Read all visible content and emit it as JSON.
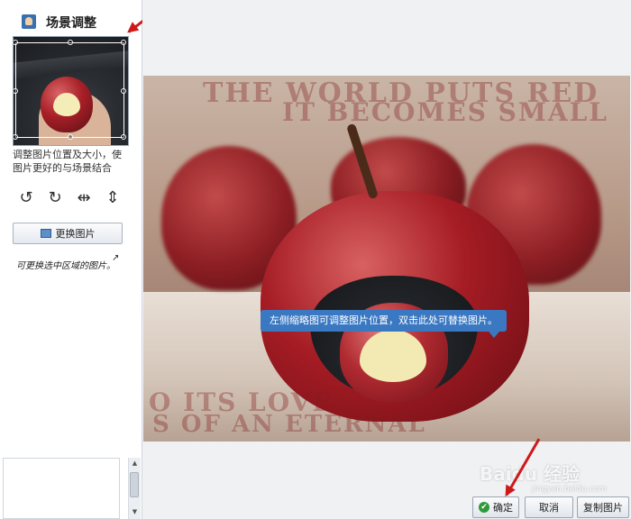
{
  "panel": {
    "title": "场景调整",
    "hint": "调整图片位置及大小，使图片更好的与场景结合",
    "tools": [
      {
        "icon": "rotate-left-icon",
        "glyph": "↺"
      },
      {
        "icon": "rotate-right-icon",
        "glyph": "↻"
      },
      {
        "icon": "flip-horizontal-icon",
        "glyph": "⇹"
      },
      {
        "icon": "flip-vertical-icon",
        "glyph": "⇕"
      }
    ],
    "replace_label": "更换图片",
    "handwritten_note": "可更换选中区域的图片。"
  },
  "preview": {
    "tooltip": "左侧缩略图可调整图片位置，双击此处可替换图片。",
    "overlay_lines": [
      "THE WORLD PUTS RED",
      "IT BECOMES SMALL",
      "O ITS LOVE",
      "S OF AN ETERNAL"
    ]
  },
  "buttons": {
    "confirm_label": "确定",
    "cancel_label": "取消",
    "copy_label": "复制图片"
  },
  "watermark": {
    "main": "Baidu 经验",
    "sub": "jingyan.baidu.com"
  },
  "colors": {
    "accent": "#3b78c2",
    "arrow": "#cc1a1a",
    "confirm": "#2f9a3a"
  }
}
